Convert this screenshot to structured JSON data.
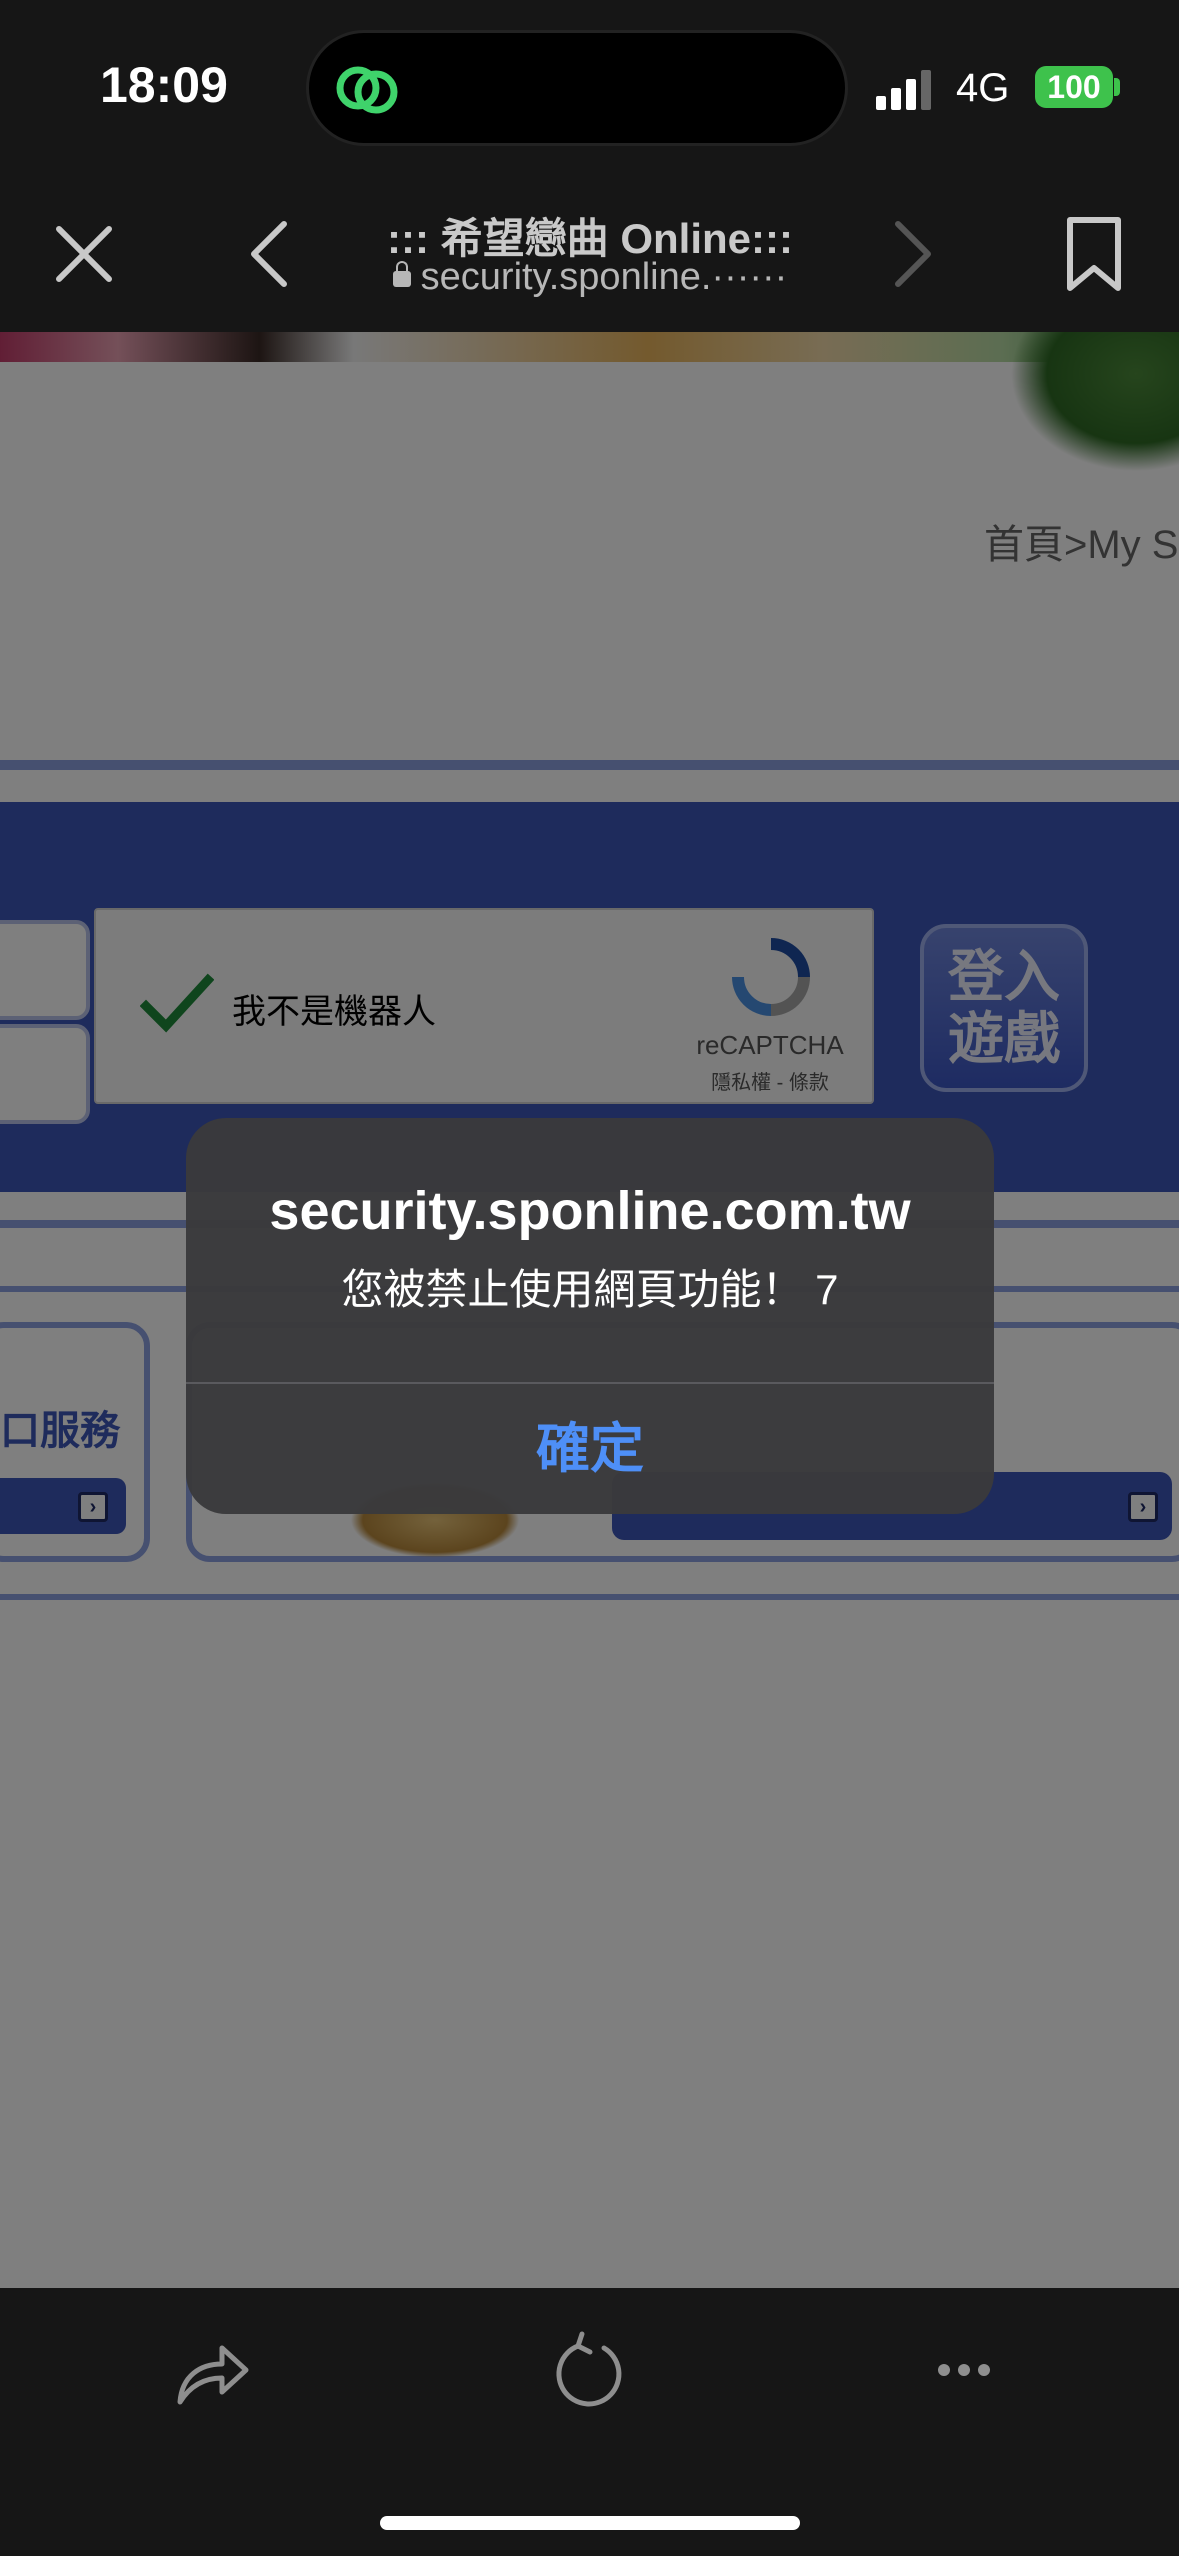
{
  "status": {
    "time": "18:09",
    "network": "4G",
    "battery": "100"
  },
  "nav": {
    "title": "::: 希望戀曲 Online:::",
    "url": "security.sponline.······"
  },
  "page": {
    "breadcrumb": "首頁>My S",
    "captcha_label": "我不是機器人",
    "recaptcha_name": "reCAPTCHA",
    "recaptcha_terms": "隱私權 - 條款",
    "login_button_line1": "登入",
    "login_button_line2": "遊戲",
    "service_text": "口服務"
  },
  "alert": {
    "title": "security.sponline.com.tw",
    "message": "您被禁止使用網頁功能！ 7",
    "confirm": "確定"
  },
  "colors": {
    "accent": "#4e8ff7",
    "battery": "#3ec24c",
    "site_blue": "#3d56b8"
  }
}
